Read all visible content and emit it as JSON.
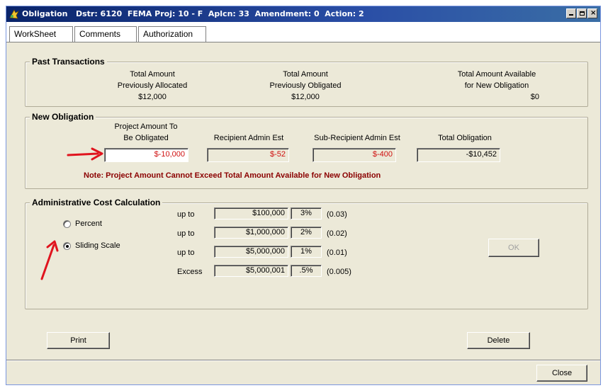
{
  "window": {
    "title": "Obligation   Dstr: 6120  FEMA Proj: 10 - F  Aplcn: 33  Amendment: 0  Action: 2"
  },
  "tabs": [
    "WorkSheet",
    "Comments",
    "Authorization"
  ],
  "past_transactions": {
    "legend": "Past Transactions",
    "columns": [
      {
        "label_line1": "Total Amount",
        "label_line2": "Previously Allocated",
        "value": "$12,000"
      },
      {
        "label_line1": "Total Amount",
        "label_line2": "Previously Obligated",
        "value": "$12,000"
      },
      {
        "label_line1": "Total Amount Available",
        "label_line2": "for New Obligation",
        "value": "$0"
      }
    ]
  },
  "new_obligation": {
    "legend": "New Obligation",
    "project_amount": {
      "label_line1": "Project Amount To",
      "label_line2": "Be Obligated",
      "value": "$-10,000"
    },
    "recipient_admin": {
      "label": "Recipient Admin Est",
      "value": "$-52"
    },
    "sub_recipient_admin": {
      "label": "Sub-Recipient Admin Est",
      "value": "$-400"
    },
    "total_obligation": {
      "label": "Total Obligation",
      "value": "-$10,452"
    },
    "note": "Note:  Project Amount Cannot Exceed Total Amount Available for New Obligation"
  },
  "admin_cost": {
    "legend": "Administrative Cost Calculation",
    "options": [
      {
        "label": "Percent",
        "selected": false
      },
      {
        "label": "Sliding Scale",
        "selected": true
      }
    ],
    "rows": [
      {
        "prefix": "up to",
        "amount": "$100,000",
        "percent": "3%",
        "decimal": "(0.03)"
      },
      {
        "prefix": "up to",
        "amount": "$1,000,000",
        "percent": "2%",
        "decimal": "(0.02)"
      },
      {
        "prefix": "up to",
        "amount": "$5,000,000",
        "percent": "1%",
        "decimal": "(0.01)"
      },
      {
        "prefix": "Excess",
        "amount": "$5,000,001",
        "percent": ".5%",
        "decimal": "(0.005)"
      }
    ],
    "ok_label": "OK"
  },
  "buttons": {
    "print": "Print",
    "delete": "Delete",
    "close": "Close"
  },
  "colors": {
    "title_bar": "#0a246a",
    "annotation_arrow": "#e0141e",
    "note_text": "#8b0000",
    "negative_value": "#d01010"
  }
}
